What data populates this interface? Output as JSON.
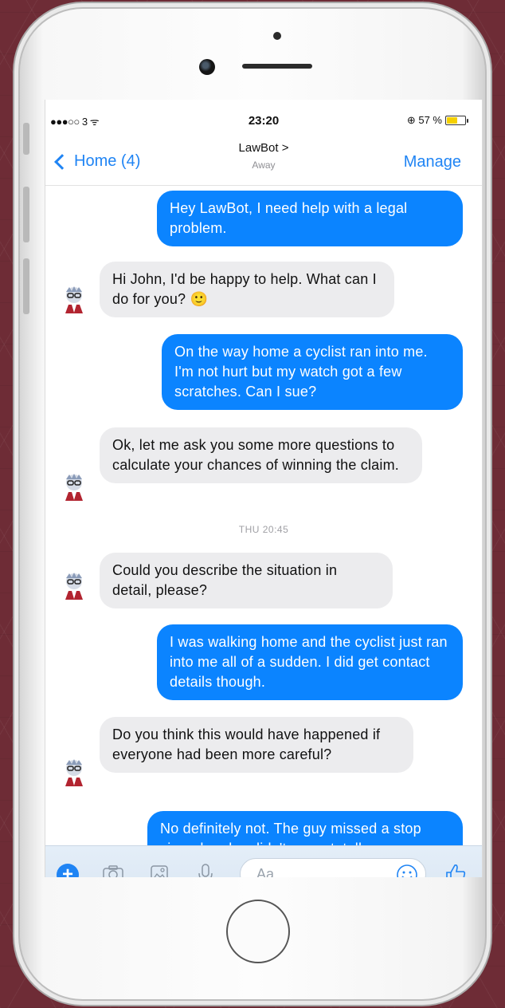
{
  "status_bar": {
    "carrier": "●●●○○ 3 ᯤ",
    "time": "23:20",
    "battery": "⊕ 57 %",
    "battery_level": 0.57
  },
  "nav": {
    "back_label": "Home (4)",
    "title": "LawBot >",
    "subtitle": "Away",
    "manage_label": "Manage"
  },
  "messages": [
    {
      "from": "user",
      "text": "Hey LawBot, I need help with a legal problem."
    },
    {
      "from": "bot",
      "text": "Hi John, I'd be happy to help. What can I do for you? 🙂"
    },
    {
      "from": "user",
      "text": "On the way home a cyclist ran into me. I'm not hurt but my watch got a few scratches. Can I sue?"
    },
    {
      "from": "bot",
      "text": "Ok, let me ask you some more questions to calculate your chances of winning the claim."
    },
    {
      "from": "timestamp",
      "text": "THU 20:45"
    },
    {
      "from": "bot",
      "text": "Could you describe the situation in detail, please?"
    },
    {
      "from": "user",
      "text": "I was walking home and the cyclist just ran into me all of a sudden. I did get contact details though."
    },
    {
      "from": "bot",
      "text": "Do you think this would have happened if everyone had been more careful?"
    },
    {
      "from": "user",
      "text": "No definitely not. The guy missed a stop sign - he also didn't seem totally"
    }
  ],
  "composer": {
    "placeholder": "Aa",
    "icons": [
      "plus-icon",
      "camera-icon",
      "image-icon",
      "microphone-icon",
      "emoji-icon",
      "thumbs-up-icon"
    ]
  },
  "colors": {
    "accent": "#1f84f4",
    "outgoing_bubble": "#0b84ff",
    "incoming_bubble": "#ececee",
    "background": "#6e2c36"
  }
}
